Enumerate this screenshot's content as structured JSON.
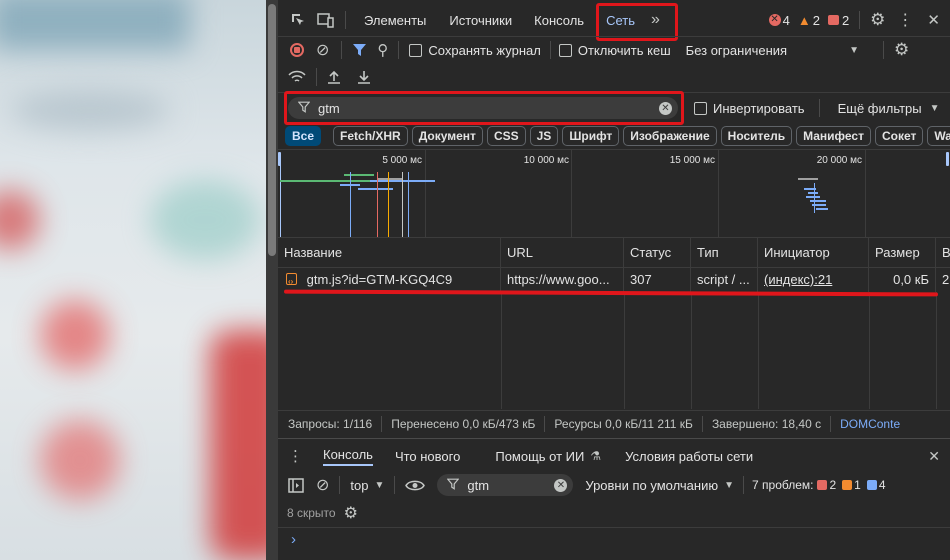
{
  "main_tabs": {
    "elements": "Элементы",
    "sources": "Источники",
    "console": "Консоль",
    "network": "Сеть",
    "more": "»"
  },
  "issues": {
    "errors": "4",
    "warnings": "2",
    "info": "2"
  },
  "toolbar": {
    "preserve_log": "Сохранять журнал",
    "disable_cache": "Отключить кеш",
    "throttling": "Без ограничения"
  },
  "filter": {
    "value": "gtm",
    "invert": "Инвертировать",
    "more_filters": "Ещё фильтры"
  },
  "type_filters": [
    "Все",
    "Fetch/XHR",
    "Документ",
    "CSS",
    "JS",
    "Шрифт",
    "Изображение",
    "Носитель",
    "Манифест",
    "Сокет",
    "Wasm"
  ],
  "timeline": {
    "ticks": [
      "5 000 мс",
      "10 000 мс",
      "15 000 мс",
      "20 000 мс"
    ]
  },
  "table": {
    "headers": [
      "Название",
      "URL",
      "Статус",
      "Тип",
      "Инициатор",
      "Размер",
      "В"
    ],
    "row": {
      "name": "gtm.js?id=GTM-KGQ4C9",
      "url": "https://www.goo...",
      "status": "307",
      "type": "script / ...",
      "initiator": "(индекс):21",
      "size": "0,0 кБ",
      "extra": "2"
    }
  },
  "status_bar": {
    "requests": "Запросы: 1/116",
    "transferred": "Перенесено 0,0 кБ/473 кБ",
    "resources": "Ресурсы 0,0 кБ/11 211 кБ",
    "finished": "Завершено: 18,40 с",
    "dom": "DOMConte"
  },
  "drawer": {
    "tabs": {
      "console": "Консоль",
      "whats_new": "Что нового",
      "ai_help": "Помощь от ИИ",
      "network_conditions": "Условия работы сети"
    },
    "context": "top",
    "filter_value": "gtm",
    "levels": "Уровни по умолчанию",
    "problems": "7 проблем:",
    "problem_counts": {
      "errors": "2",
      "warnings": "1",
      "info": "4"
    },
    "hidden": "8 скрыто",
    "prompt": "›"
  },
  "colors": {
    "accent": "#a8c7fa",
    "error": "#e46962",
    "warning": "#f28b30",
    "annotation": "#e0161b"
  }
}
